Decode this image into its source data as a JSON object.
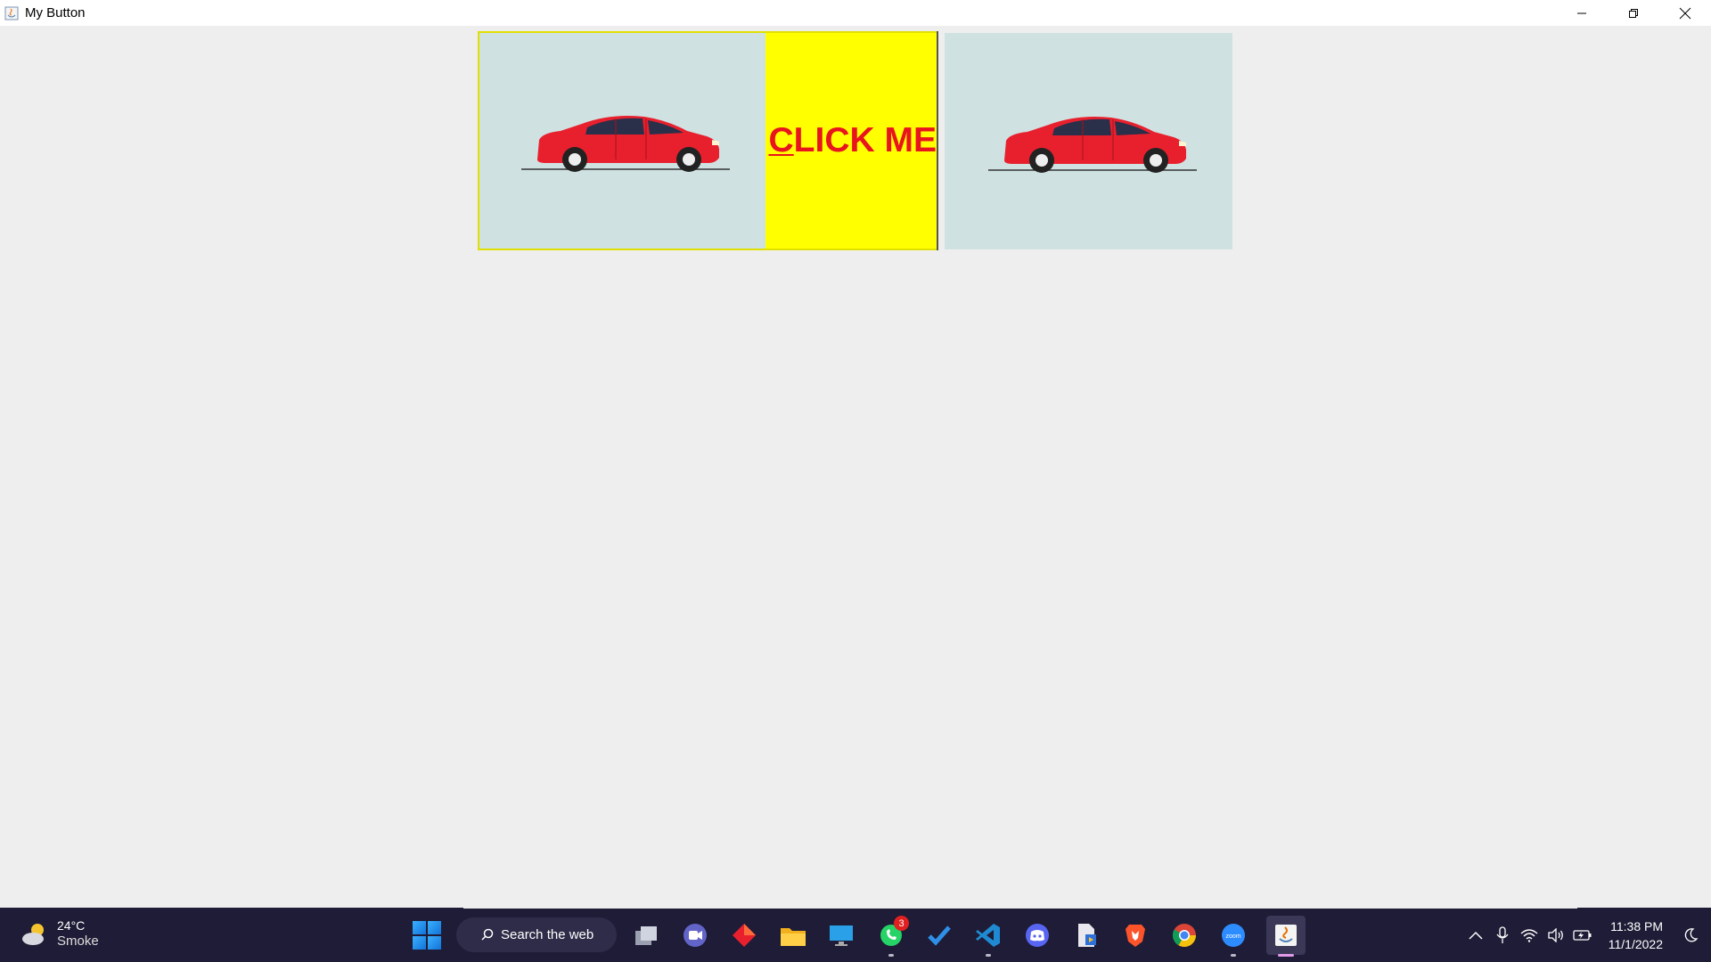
{
  "window": {
    "title": "My Button",
    "controls": [
      "minimize",
      "restore",
      "close"
    ]
  },
  "main_button": {
    "label_mnemonic": "C",
    "label_rest": "LICK ME",
    "image": "red-car",
    "background": "#ffff00",
    "text_color": "#e8141e"
  },
  "second_panel": {
    "image": "red-car"
  },
  "taskbar": {
    "weather": {
      "temp": "24°C",
      "desc": "Smoke"
    },
    "search_label": "Search the web",
    "apps": [
      "start",
      "task-view",
      "teams-chat",
      "app-diamond",
      "file-explorer",
      "remote-desktop",
      "whatsapp",
      "todo",
      "vscode",
      "discord",
      "file-app",
      "brave",
      "chrome",
      "zoom",
      "java"
    ],
    "whatsapp_badge": "3",
    "zoom_label": "zoom",
    "clock": {
      "time": "11:38 PM",
      "date": "11/1/2022"
    }
  }
}
